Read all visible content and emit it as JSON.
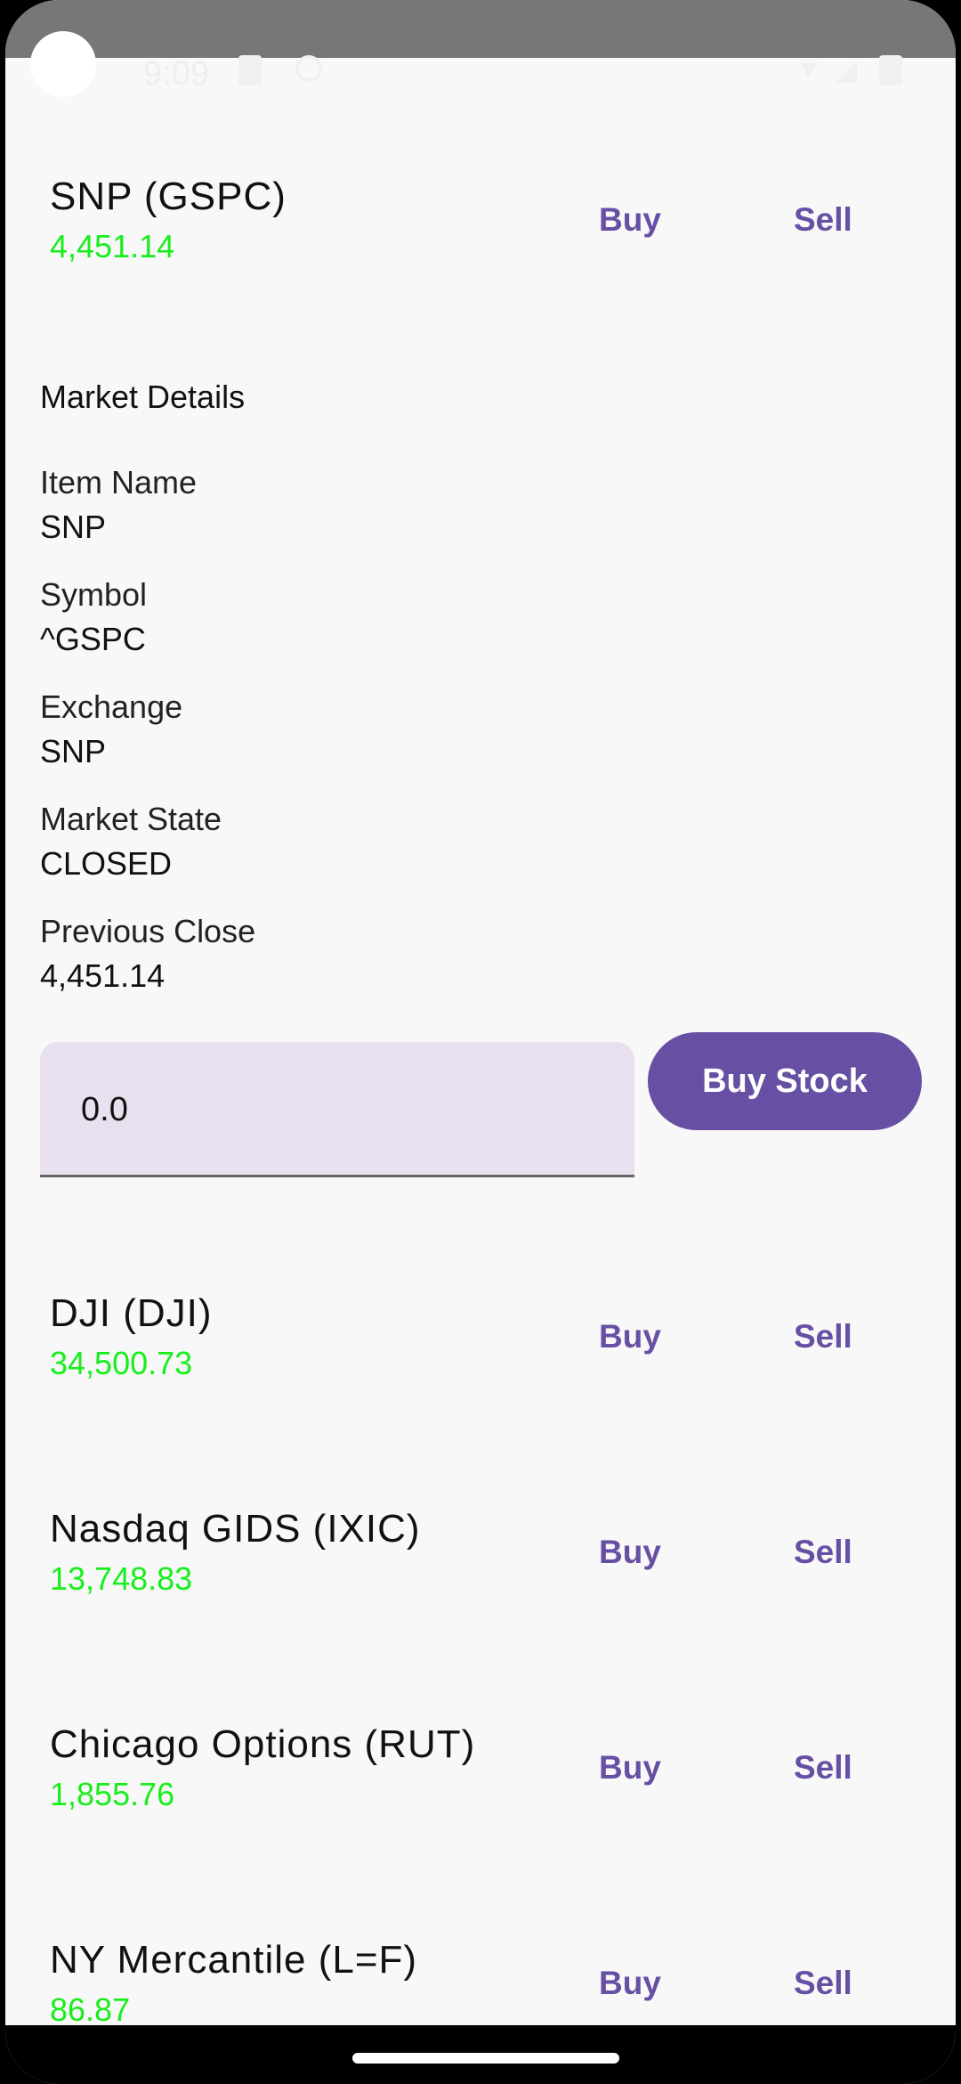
{
  "status_bar": {
    "time": "9:09"
  },
  "indices": [
    {
      "title": "SNP (GSPC)",
      "price": "4,451.14",
      "buy": "Buy",
      "sell": "Sell"
    },
    {
      "title": "DJI (DJI)",
      "price": "34,500.73",
      "buy": "Buy",
      "sell": "Sell"
    },
    {
      "title": "Nasdaq GIDS (IXIC)",
      "price": "13,748.83",
      "buy": "Buy",
      "sell": "Sell"
    },
    {
      "title": "Chicago Options (RUT)",
      "price": "1,855.76",
      "buy": "Buy",
      "sell": "Sell"
    },
    {
      "title": "NY Mercantile (L=F)",
      "price": "86.87",
      "buy": "Buy",
      "sell": "Sell"
    }
  ],
  "details": {
    "heading": "Market Details",
    "fields": [
      {
        "label": "Item Name",
        "value": "SNP"
      },
      {
        "label": "Symbol",
        "value": "^GSPC"
      },
      {
        "label": "Exchange",
        "value": "SNP"
      },
      {
        "label": "Market State",
        "value": "CLOSED"
      },
      {
        "label": "Previous Close",
        "value": "4,451.14"
      }
    ]
  },
  "order": {
    "quantity_value": "0.0",
    "buy_stock_label": "Buy Stock"
  },
  "colors": {
    "accent": "#6750a4",
    "price_green": "#18ee1c",
    "input_bg": "#e8e0ee"
  }
}
